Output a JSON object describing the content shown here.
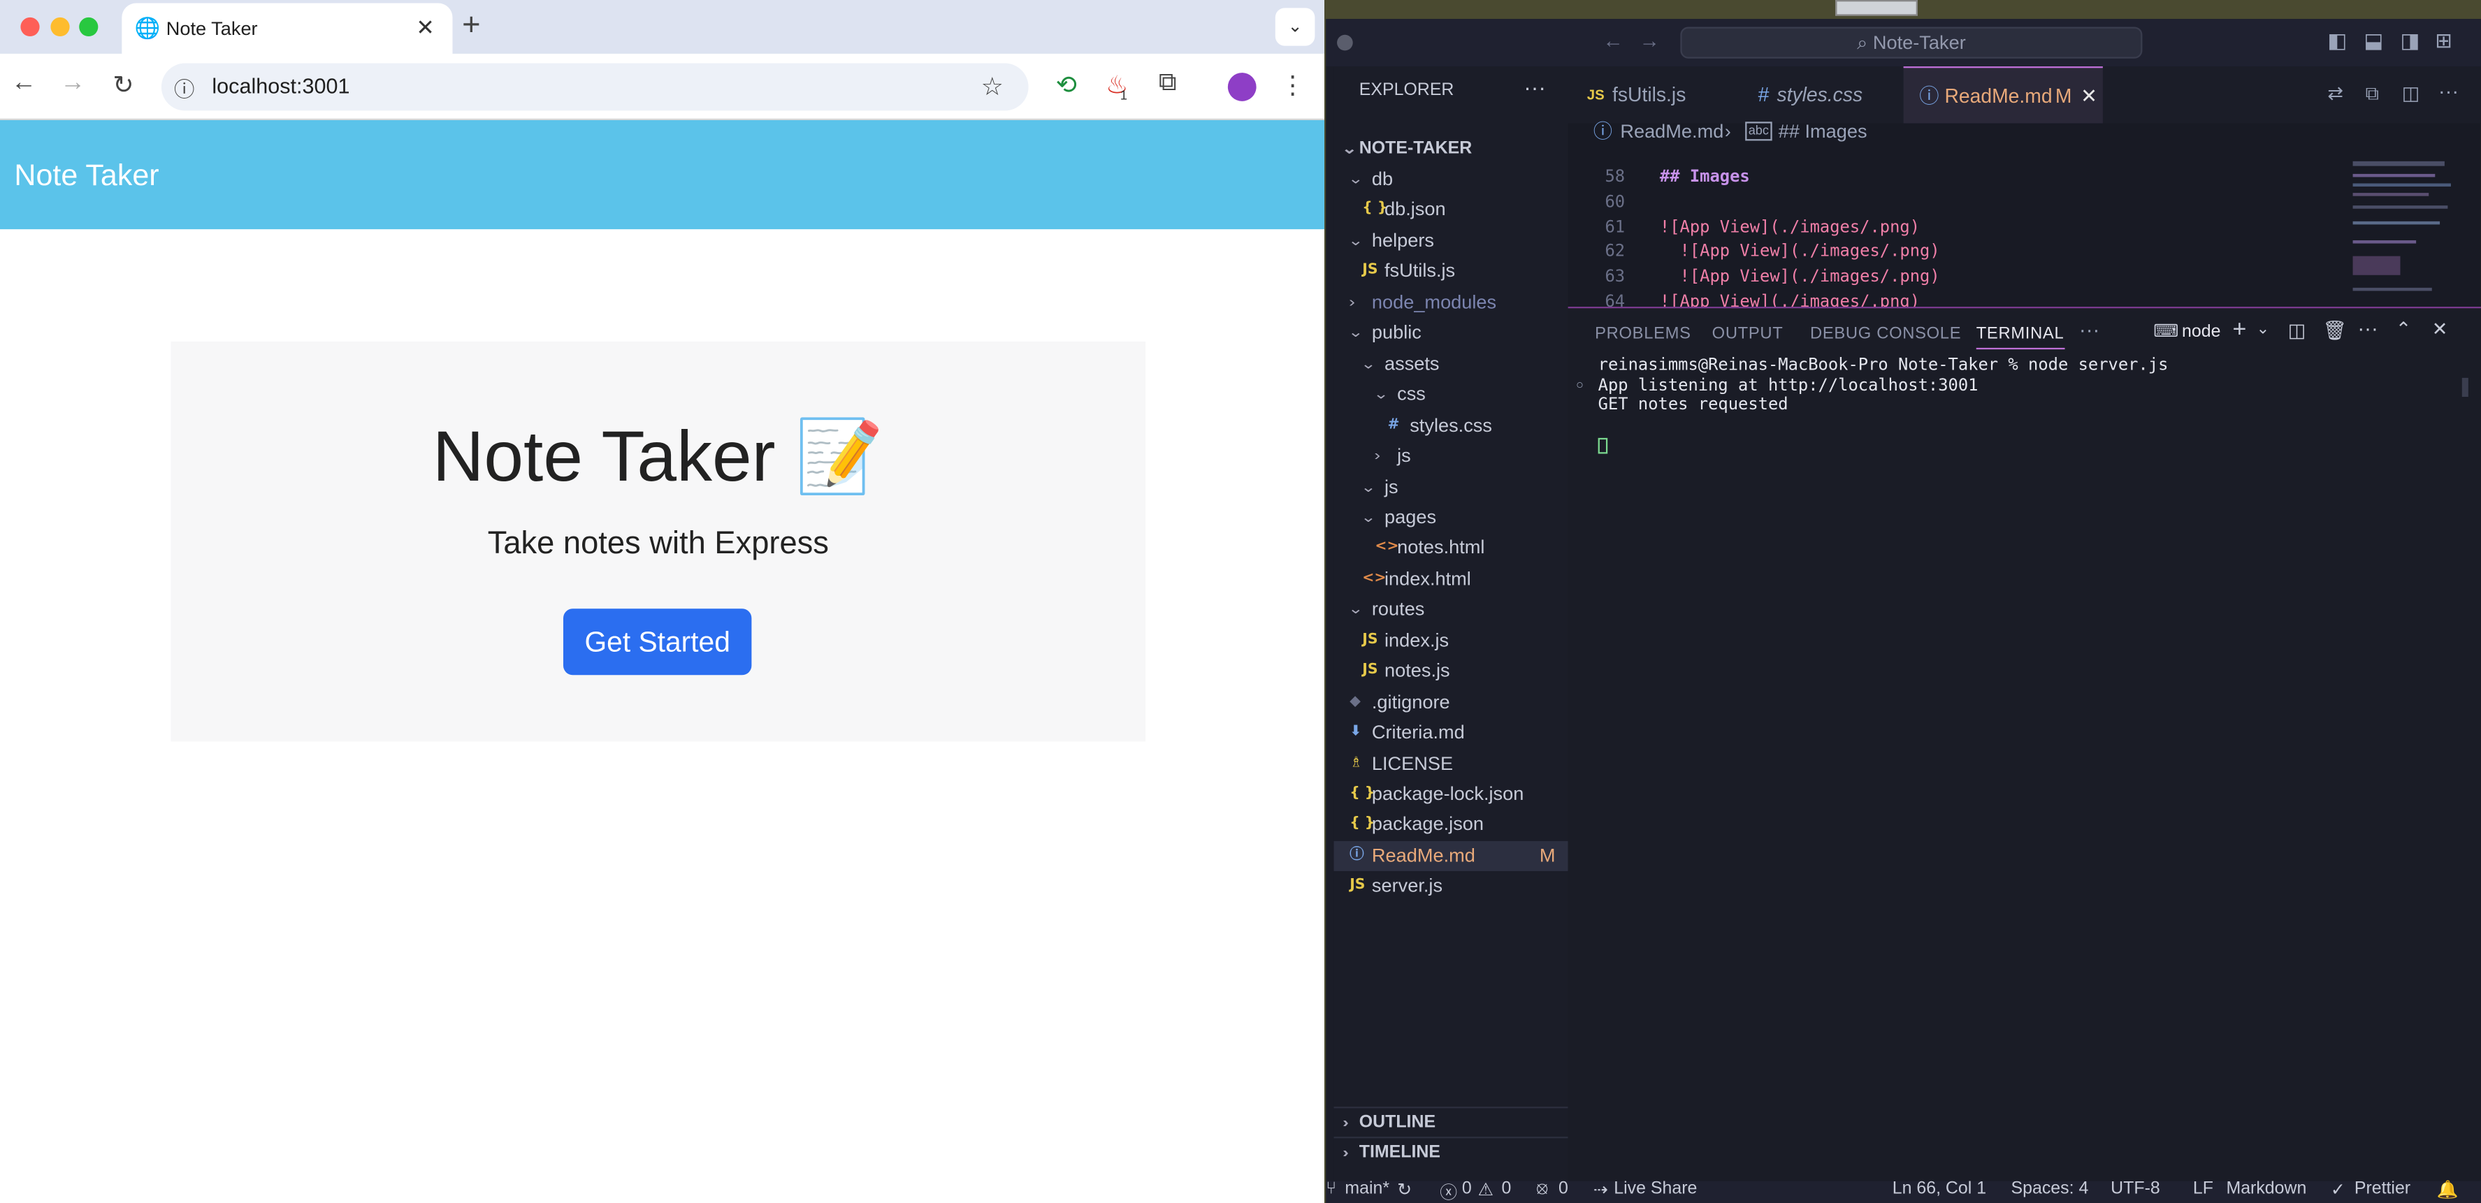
{
  "browser": {
    "tab_title": "Note Taker",
    "url": "localhost:3001",
    "extension_badge": "1",
    "page": {
      "navbar_brand": "Note Taker",
      "heading": "Note Taker 📝",
      "lead": "Take notes with Express",
      "cta_label": "Get Started"
    }
  },
  "vscode": {
    "command_center": "Note-Taker",
    "explorer_title": "EXPLORER",
    "project": "NOTE-TAKER",
    "tree": [
      {
        "label": "db",
        "type": "folder",
        "open": true,
        "depth": 1
      },
      {
        "label": "db.json",
        "type": "json",
        "depth": 2
      },
      {
        "label": "helpers",
        "type": "folder",
        "open": true,
        "depth": 1
      },
      {
        "label": "fsUtils.js",
        "type": "js",
        "depth": 2
      },
      {
        "label": "node_modules",
        "type": "folder",
        "open": false,
        "depth": 1
      },
      {
        "label": "public",
        "type": "folder",
        "open": true,
        "depth": 1
      },
      {
        "label": "assets",
        "type": "folder",
        "open": true,
        "depth": 2
      },
      {
        "label": "css",
        "type": "folder",
        "open": true,
        "depth": 3
      },
      {
        "label": "styles.css",
        "type": "css",
        "depth": 4
      },
      {
        "label": "js",
        "type": "folder",
        "open": false,
        "depth": 3
      },
      {
        "label": "js",
        "type": "folder",
        "open": true,
        "depth": 2
      },
      {
        "label": "pages",
        "type": "folder",
        "open": true,
        "depth": 2
      },
      {
        "label": "notes.html",
        "type": "html",
        "depth": 3
      },
      {
        "label": "index.html",
        "type": "html",
        "depth": 2
      },
      {
        "label": "routes",
        "type": "folder",
        "open": true,
        "depth": 1
      },
      {
        "label": "index.js",
        "type": "js",
        "depth": 2
      },
      {
        "label": "notes.js",
        "type": "js",
        "depth": 2
      },
      {
        "label": ".gitignore",
        "type": "git",
        "depth": 1
      },
      {
        "label": "Criteria.md",
        "type": "md",
        "depth": 1
      },
      {
        "label": "LICENSE",
        "type": "license",
        "depth": 1
      },
      {
        "label": "package-lock.json",
        "type": "json",
        "depth": 1
      },
      {
        "label": "package.json",
        "type": "json",
        "depth": 1
      },
      {
        "label": "ReadMe.md",
        "type": "info",
        "depth": 1,
        "selected": true,
        "badge": "M"
      },
      {
        "label": "server.js",
        "type": "js",
        "depth": 1
      }
    ],
    "outline": "OUTLINE",
    "timeline": "TIMELINE",
    "tabs": [
      {
        "label": "fsUtils.js",
        "icon": "JS"
      },
      {
        "label": "styles.css",
        "icon": "#"
      },
      {
        "label": "ReadMe.md",
        "icon": "ⓘ",
        "badge": "M",
        "active": true
      }
    ],
    "breadcrumb": {
      "file": "ReadMe.md",
      "section": "## Images"
    },
    "code": [
      {
        "n": "58",
        "text": "## Images"
      },
      {
        "n": "60",
        "text": ""
      },
      {
        "n": "61",
        "text": "![App View](./images/.png)"
      },
      {
        "n": "62",
        "text": "  ![App View](./images/.png)"
      },
      {
        "n": "63",
        "text": "  ![App View](./images/.png)"
      },
      {
        "n": "64",
        "text": "![App View](./images/.png)"
      }
    ],
    "panel_tabs": [
      "PROBLEMS",
      "OUTPUT",
      "DEBUG CONSOLE",
      "TERMINAL"
    ],
    "terminal_name": "node",
    "terminal": [
      "reinasimms@Reinas-MacBook-Pro Note-Taker % node server.js",
      "App listening at http://localhost:3001",
      "GET notes requested"
    ],
    "status": {
      "branch": "main*",
      "errors": "0",
      "warnings": "0",
      "ports": "0",
      "live_share": "Live Share",
      "cursor": "Ln 66, Col 1",
      "spaces": "Spaces: 4",
      "encoding": "UTF-8",
      "eol": "LF",
      "language": "Markdown",
      "formatter": "Prettier"
    }
  }
}
